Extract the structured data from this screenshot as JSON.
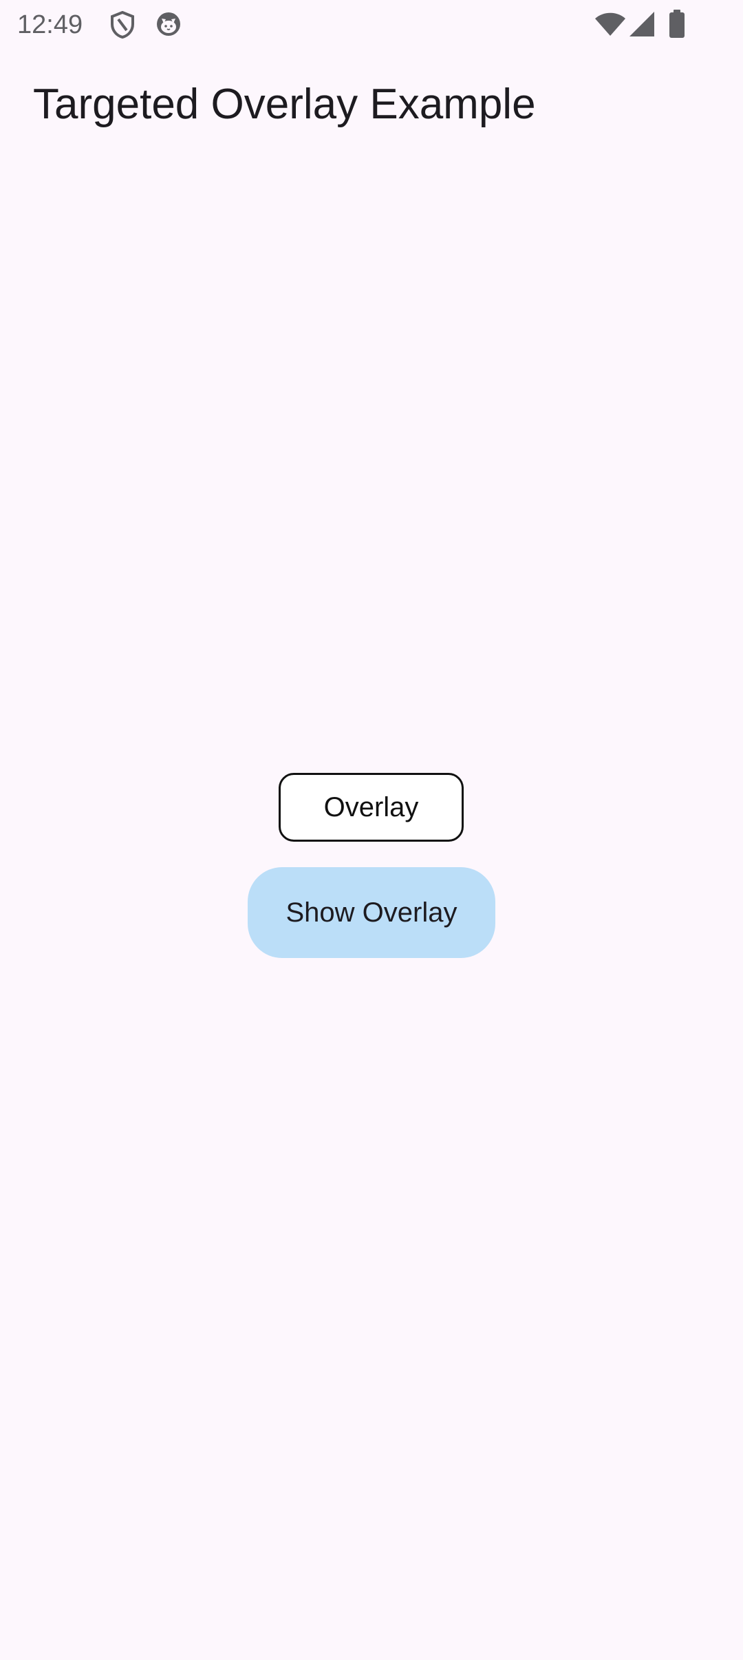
{
  "status_bar": {
    "time": "12:49",
    "left_icons": [
      "shield-icon",
      "cat-face-icon"
    ],
    "right_icons": [
      "wifi-icon",
      "cellular-signal-icon",
      "battery-icon"
    ],
    "icon_color": "#5f5f63"
  },
  "app_bar": {
    "title": "Targeted Overlay Example"
  },
  "main": {
    "overlay_label": "Overlay",
    "show_overlay_button_label": "Show Overlay"
  },
  "colors": {
    "background": "#fdf7fd",
    "button_fill": "#bbdef8",
    "overlay_border": "#111111"
  }
}
